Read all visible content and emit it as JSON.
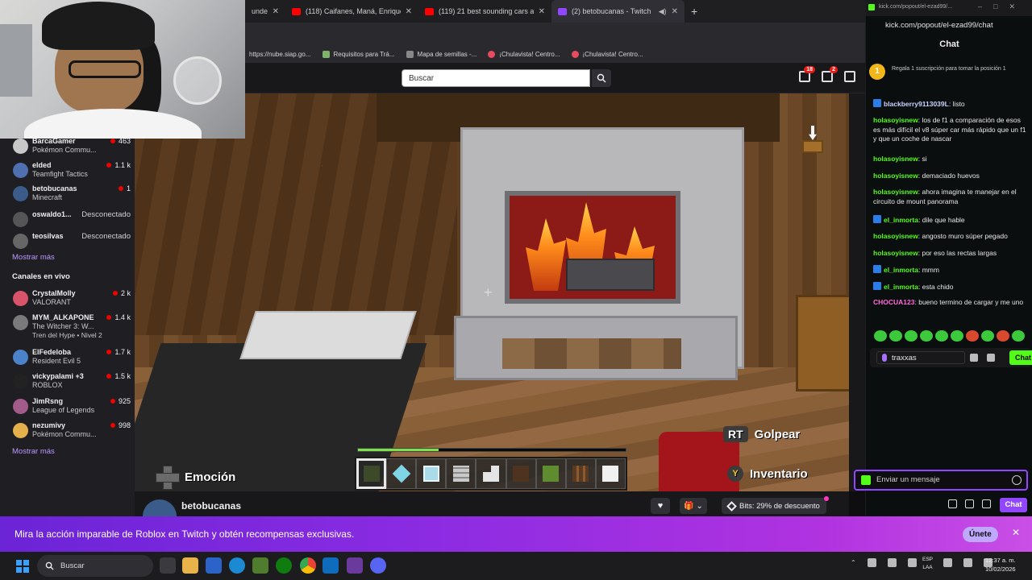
{
  "browser": {
    "tabs": [
      {
        "title": "unde",
        "icon": "youtube-icon"
      },
      {
        "title": "(118) Caifanes, Maná, Enrique B",
        "icon": "youtube-icon"
      },
      {
        "title": "(119) 21 best sounding cars at",
        "icon": "youtube-icon"
      },
      {
        "title": "(2) betobucanas - Twitch",
        "icon": "twitch-icon"
      }
    ],
    "bookmarks": [
      {
        "label": "https://nube.siap.go...",
        "icon": "globe-icon"
      },
      {
        "label": "Requisitos para Trá...",
        "icon": "doc-icon"
      },
      {
        "label": "Mapa de semillas -...",
        "icon": "seed-icon"
      },
      {
        "label": "¡Chulavista! Centro...",
        "icon": "chulavista-icon"
      },
      {
        "label": "¡Chulavista! Centro...",
        "icon": "chulavista-icon"
      }
    ]
  },
  "twitch": {
    "search_placeholder": "Buscar",
    "badges": {
      "notifications": "18",
      "inbox": "2"
    },
    "followed": [
      {
        "name": "BarcaGamer",
        "game": "Pokémon Commu...",
        "viewers": "463",
        "color": "#c8c8c8"
      },
      {
        "name": "elded",
        "game": "Teamfight Tactics",
        "viewers": "1.1 k",
        "color": "#4f6fae"
      },
      {
        "name": "betobucanas",
        "game": "Minecraft",
        "viewers": "1",
        "color": "#3b5c8a"
      },
      {
        "name": "oswaldo1...",
        "status": "Desconectado",
        "color": "#555"
      },
      {
        "name": "teosilvas",
        "status": "Desconectado",
        "color": "#666"
      }
    ],
    "show_more": "Mostrar más",
    "live_header": "Canales en vivo",
    "live": [
      {
        "name": "CrystalMolly",
        "game": "VALORANT",
        "viewers": "2 k",
        "color": "#d9536b"
      },
      {
        "name": "MYM_ALKAPONE",
        "game": "The Witcher 3: W...",
        "extra": "Tren del Hype • Nivel 2",
        "viewers": "1.4 k",
        "color": "#7a7a7a"
      },
      {
        "name": "ElFedeloba",
        "game": "Resident Evil 5",
        "viewers": "1.7 k",
        "color": "#4c82c9"
      },
      {
        "name": "vickypalami +3",
        "game": "ROBLOX",
        "viewers": "1.5 k",
        "color": "#222"
      },
      {
        "name": "JimRsng",
        "game": "League of Legends",
        "viewers": "925",
        "color": "#a25b8a"
      },
      {
        "name": "nezumivy",
        "game": "Pokémon Commu...",
        "viewers": "998",
        "color": "#e3b04b"
      }
    ],
    "show_more_2": "Mostrar más",
    "streamer": "betobucanas",
    "bits_label": "Bits: 29% de descuento",
    "banner": {
      "message": "Mira la acción imparable de Roblox en Twitch y obtén recompensas exclusivas.",
      "join": "Únete"
    }
  },
  "game": {
    "emote_label": "Emoción",
    "hit_button": "RT",
    "hit_label": "Golpear",
    "inventory_button": "Y",
    "inventory_label": "Inventario",
    "xp_fraction": 0.3,
    "hotbar": [
      "grass-block-item",
      "diamond-item",
      "glass-item",
      "ladder-item",
      "quartz-stairs-item",
      "wood-planks-item",
      "moss-item",
      "trapdoor-item",
      "white-block-item"
    ],
    "selected_slot": 0
  },
  "chat": {
    "url_short": "kick.com/popout/el-ezad99/...",
    "address": "kick.com/popout/el-ezad99/chat",
    "title": "Chat",
    "sub_promo": "Regala 1 suscripción para tomar la posición 1",
    "messages": [
      {
        "user": "blackberry9113039L",
        "text": ": listo",
        "color": "#c8d3ff",
        "badge": true
      },
      {
        "user": "holasoyisnew",
        "text": ": los de f1 a comparación de esos es más difícil el v8 súper car más rápido que un f1 y que un coche de nascar",
        "color": "#53fc18"
      },
      {
        "user": "holasoyisnew",
        "text": ": si",
        "color": "#53fc18"
      },
      {
        "user": "holasoyisnew",
        "text": ": demaciado huevos",
        "color": "#53fc18"
      },
      {
        "user": "holasoyisnew",
        "text": ": ahora imagina te manejar en el circuito de mount panorama",
        "color": "#53fc18"
      },
      {
        "user": "el_inmorta",
        "text": ": dile que hable",
        "color": "#53fc18",
        "badge": true
      },
      {
        "user": "holasoyisnew",
        "text": ": angosto muro súper pegado",
        "color": "#53fc18"
      },
      {
        "user": "holasoyisnew",
        "text": ": por eso las rectas largas",
        "color": "#53fc18"
      },
      {
        "user": "el_inmorta",
        "text": ": mmm",
        "color": "#53fc18",
        "badge": true
      },
      {
        "user": "el_inmorta",
        "text": ": esta chido",
        "color": "#53fc18",
        "badge": true
      },
      {
        "user": "CHOCUA123",
        "text": ": bueno termino de cargar y me uno",
        "color": "#ff6bd6"
      }
    ],
    "owner": "traxxas",
    "chat_button": "Chat",
    "input_placeholder": "Enviar un mensaje",
    "send_button": "Chat"
  },
  "taskbar": {
    "search": "Buscar",
    "lang": "ESP",
    "lang2": "LAA",
    "time": "12:37 a. m.",
    "date": "10/02/2026"
  }
}
